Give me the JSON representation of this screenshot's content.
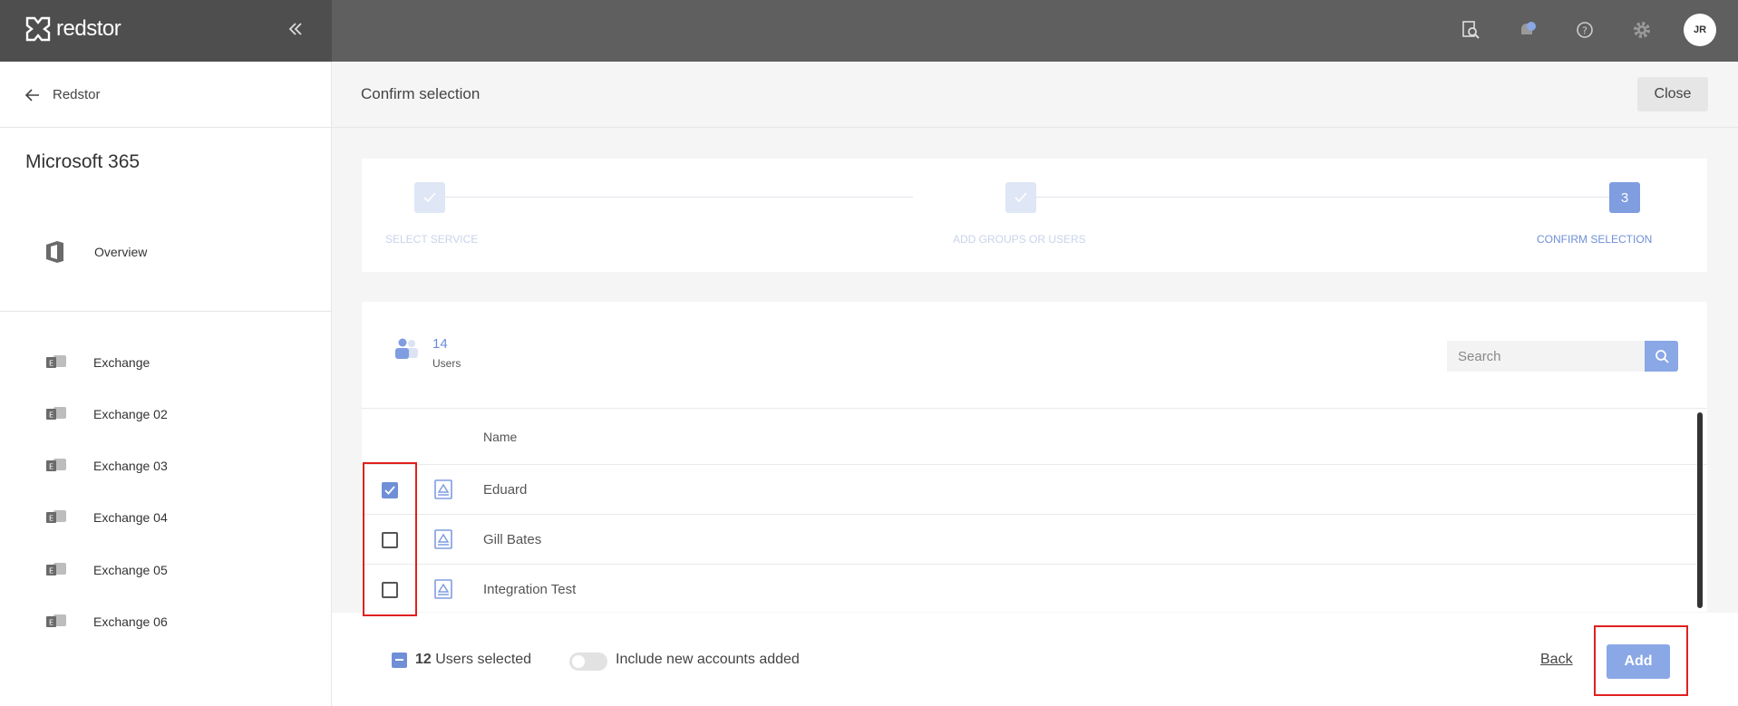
{
  "app": {
    "brand": "redstor",
    "user_initials": "JR",
    "top_icons": [
      "search-report-icon",
      "notifications-icon",
      "help-icon",
      "settings-icon"
    ]
  },
  "sidebar": {
    "back_label": "Redstor",
    "title": "Microsoft 365",
    "overview_label": "Overview",
    "services": [
      {
        "label": "Exchange",
        "icon": "exchange-icon"
      },
      {
        "label": "Exchange 02",
        "icon": "exchange-icon"
      },
      {
        "label": "Exchange 03",
        "icon": "exchange-icon"
      },
      {
        "label": "Exchange 04",
        "icon": "exchange-icon"
      },
      {
        "label": "Exchange 05",
        "icon": "exchange-icon"
      },
      {
        "label": "Exchange 06",
        "icon": "exchange-icon"
      }
    ]
  },
  "header": {
    "title": "Confirm selection",
    "close_label": "Close"
  },
  "stepper": {
    "steps": [
      {
        "label": "SELECT SERVICE",
        "state": "done"
      },
      {
        "label": "ADD GROUPS OR USERS",
        "state": "done"
      },
      {
        "label": "CONFIRM SELECTION",
        "state": "active",
        "number": "3"
      }
    ]
  },
  "users": {
    "count": "14",
    "count_label": "Users",
    "search_placeholder": "Search",
    "column_name": "Name",
    "rows": [
      {
        "name": "Eduard",
        "checked": true
      },
      {
        "name": "Gill Bates",
        "checked": false
      },
      {
        "name": "Integration Test",
        "checked": false
      }
    ]
  },
  "footer": {
    "selected_count": "12",
    "selected_label": "Users selected",
    "toggle_label": "Include new accounts added",
    "back_label": "Back",
    "add_label": "Add"
  },
  "colors": {
    "accent": "#6f8fd6",
    "accent_light": "#8aa7e6",
    "topbar": "#5f5f5f",
    "highlight": "#e02020"
  }
}
